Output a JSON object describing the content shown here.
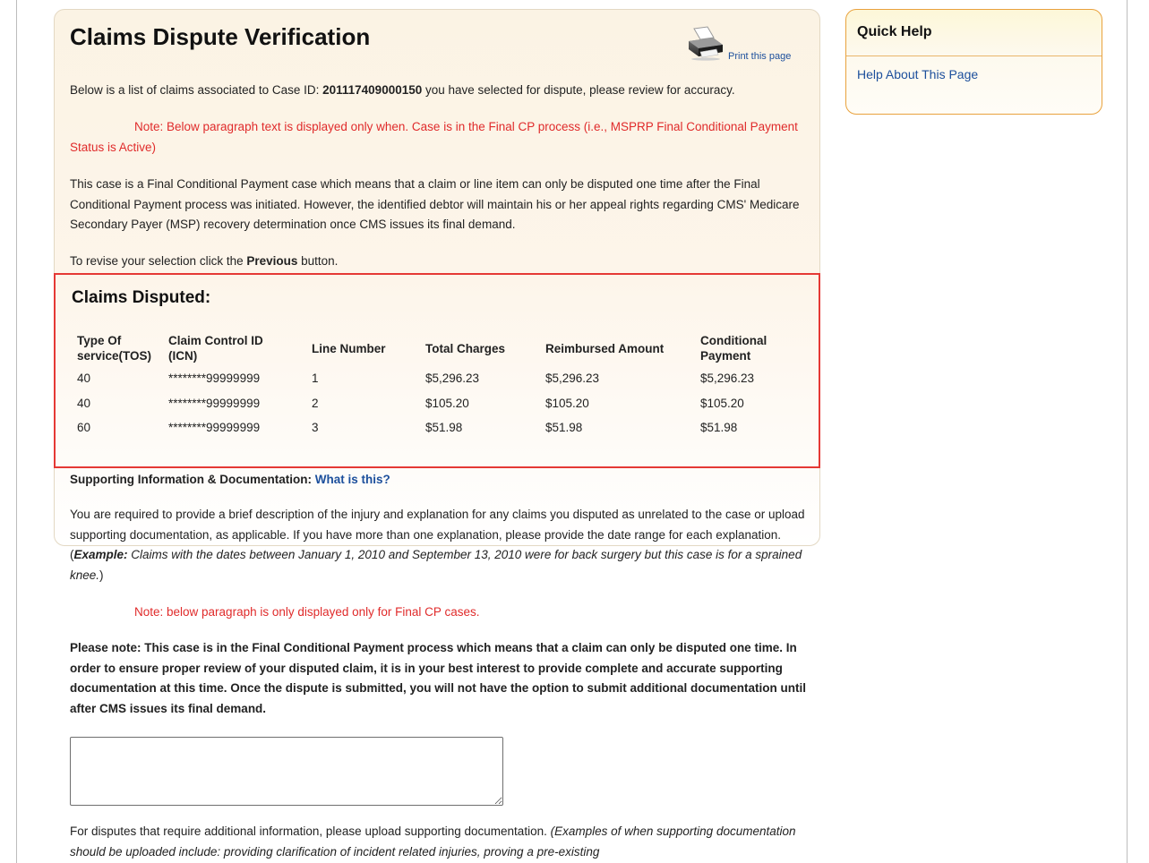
{
  "page": {
    "title": "Claims Dispute Verification",
    "print_label": "Print this page",
    "intro_prefix": "Below is a list of claims associated to Case ID: ",
    "case_id": "201117409000150",
    "intro_suffix": " you have selected for dispute, please review for accuracy.",
    "note_final_cp": "Note: Below paragraph text is displayed only when. Case is in the Final CP process (i.e., MSPRP Final Conditional Payment Status is Active)",
    "final_cp_paragraph": "This case is a Final Conditional Payment case which means that a claim or line item can only be disputed one time after the Final Conditional Payment process was initiated. However, the identified debtor will maintain his or her appeal rights regarding CMS' Medicare Secondary Payer (MSP) recovery determination once CMS issues its final demand.",
    "revise_prefix": "To revise your selection click the ",
    "revise_bold": "Previous",
    "revise_suffix": " button."
  },
  "claims": {
    "title": "Claims Disputed:",
    "headers": {
      "tos_line1": "Type Of",
      "tos_line2": "service(TOS)",
      "icn_line1": "Claim Control ID",
      "icn_line2": "(ICN)",
      "line_number": "Line Number",
      "total_charges": "Total Charges",
      "reimbursed": "Reimbursed Amount",
      "cp_line1": "Conditional",
      "cp_line2": "Payment"
    },
    "rows": [
      {
        "tos": "40",
        "icn": "********99999999",
        "line": "1",
        "total": "$5,296.23",
        "reimbursed": "$5,296.23",
        "conditional": "$5,296.23"
      },
      {
        "tos": "40",
        "icn": "********99999999",
        "line": "2",
        "total": "$105.20",
        "reimbursed": "$105.20",
        "conditional": "$105.20"
      },
      {
        "tos": "60",
        "icn": "********99999999",
        "line": "3",
        "total": "$51.98",
        "reimbursed": "$51.98",
        "conditional": "$51.98"
      }
    ]
  },
  "supporting": {
    "heading": "Supporting Information & Documentation: ",
    "what_link": "What is this?",
    "required_text": "You are required to provide a brief description of the injury and explanation for any claims you disputed as unrelated to the case or upload supporting documentation, as applicable. If you have more than one explanation, please provide the date range for each explanation. (",
    "example_label": "Example:",
    "example_text": " Claims with the dates between January 1, 2010 and September 13, 2010 were for back surgery but this case is for a sprained knee.",
    "required_close": ")",
    "note_final_only": "Note: below paragraph is only displayed only for Final CP cases.",
    "please_note": "Please note: This case is in the Final Conditional Payment process which means that a claim can only be disputed one time. In order to ensure proper review of your disputed claim, it is in your best interest to provide complete and accurate supporting documentation at this time. Once the dispute is submitted, you will not have the option to submit additional documentation until after CMS issues its final demand.",
    "textarea_value": "",
    "upload_text": "For disputes that require additional information, please upload supporting documentation. ",
    "upload_examples": "(Examples of when supporting documentation should be uploaded include: providing clarification of incident related injuries, proving a pre-existing"
  },
  "quick_help": {
    "title": "Quick Help",
    "link": "Help About This Page"
  },
  "icons": {
    "print": "printer-icon"
  },
  "colors": {
    "link": "#1c4f9c",
    "note_red": "#e02b2b",
    "highlight_border": "#e53935",
    "panel_border": "#e9a23d"
  }
}
